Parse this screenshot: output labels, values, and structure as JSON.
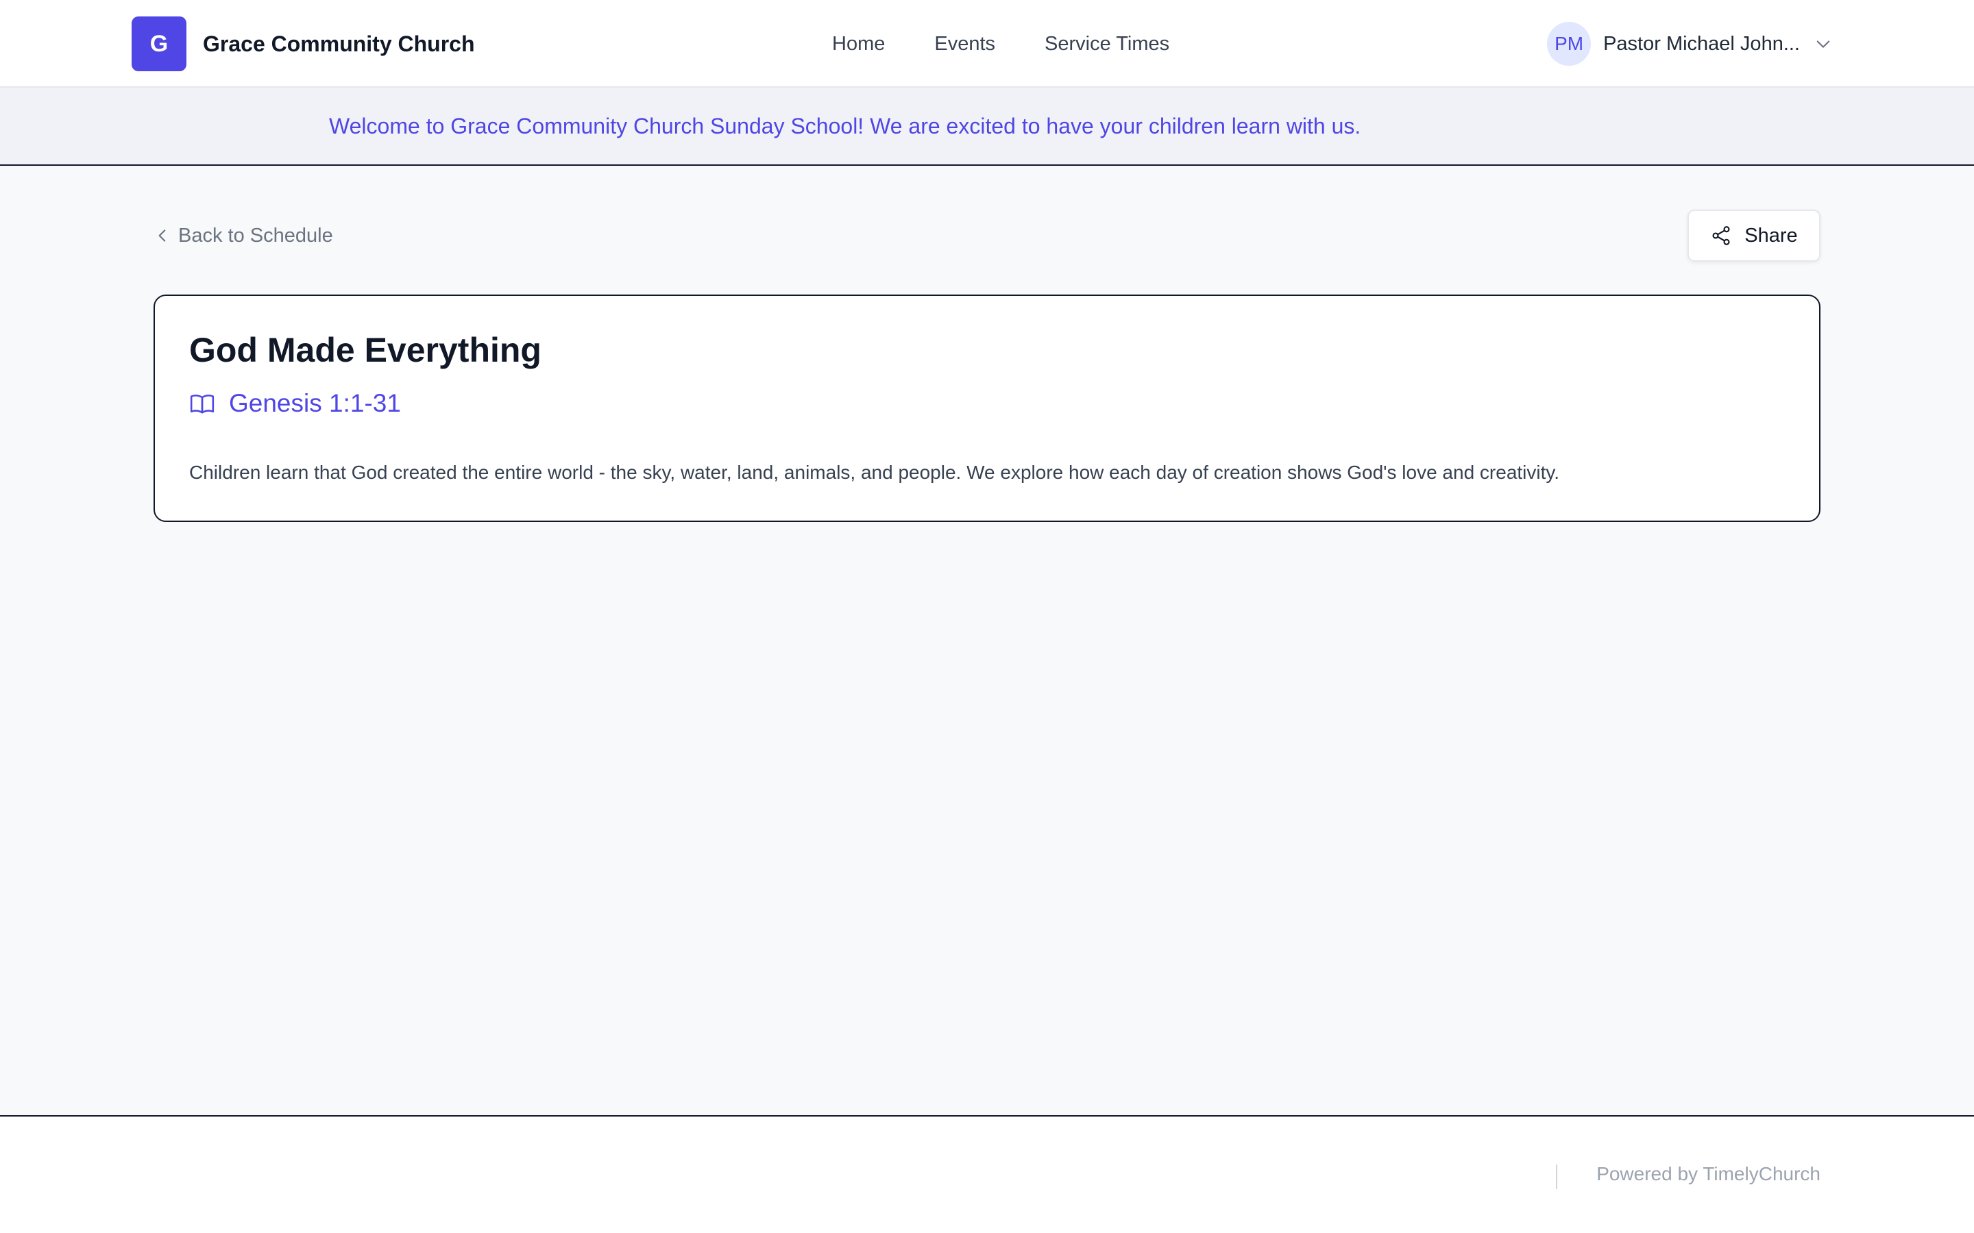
{
  "header": {
    "logo_letter": "G",
    "church_name": "Grace Community Church",
    "nav": [
      {
        "label": "Home"
      },
      {
        "label": "Events"
      },
      {
        "label": "Service Times"
      }
    ],
    "user": {
      "initials": "PM",
      "name": "Pastor Michael John..."
    }
  },
  "banner": {
    "text": "Welcome to Grace Community Church Sunday School! We are excited to have your children learn with us."
  },
  "main": {
    "back_label": "Back to Schedule",
    "share_label": "Share",
    "lesson": {
      "title": "God Made Everything",
      "scripture": "Genesis 1:1-31",
      "description": "Children learn that God created the entire world - the sky, water, land, animals, and people. We explore how each day of creation shows God's love and creativity."
    }
  },
  "footer": {
    "powered_by": "Powered by TimelyChurch"
  },
  "colors": {
    "accent": "#4f46e5",
    "background": "#f8f9fb"
  },
  "icons": [
    "chevron-down-icon",
    "chevron-left-icon",
    "share-icon",
    "book-open-icon"
  ]
}
